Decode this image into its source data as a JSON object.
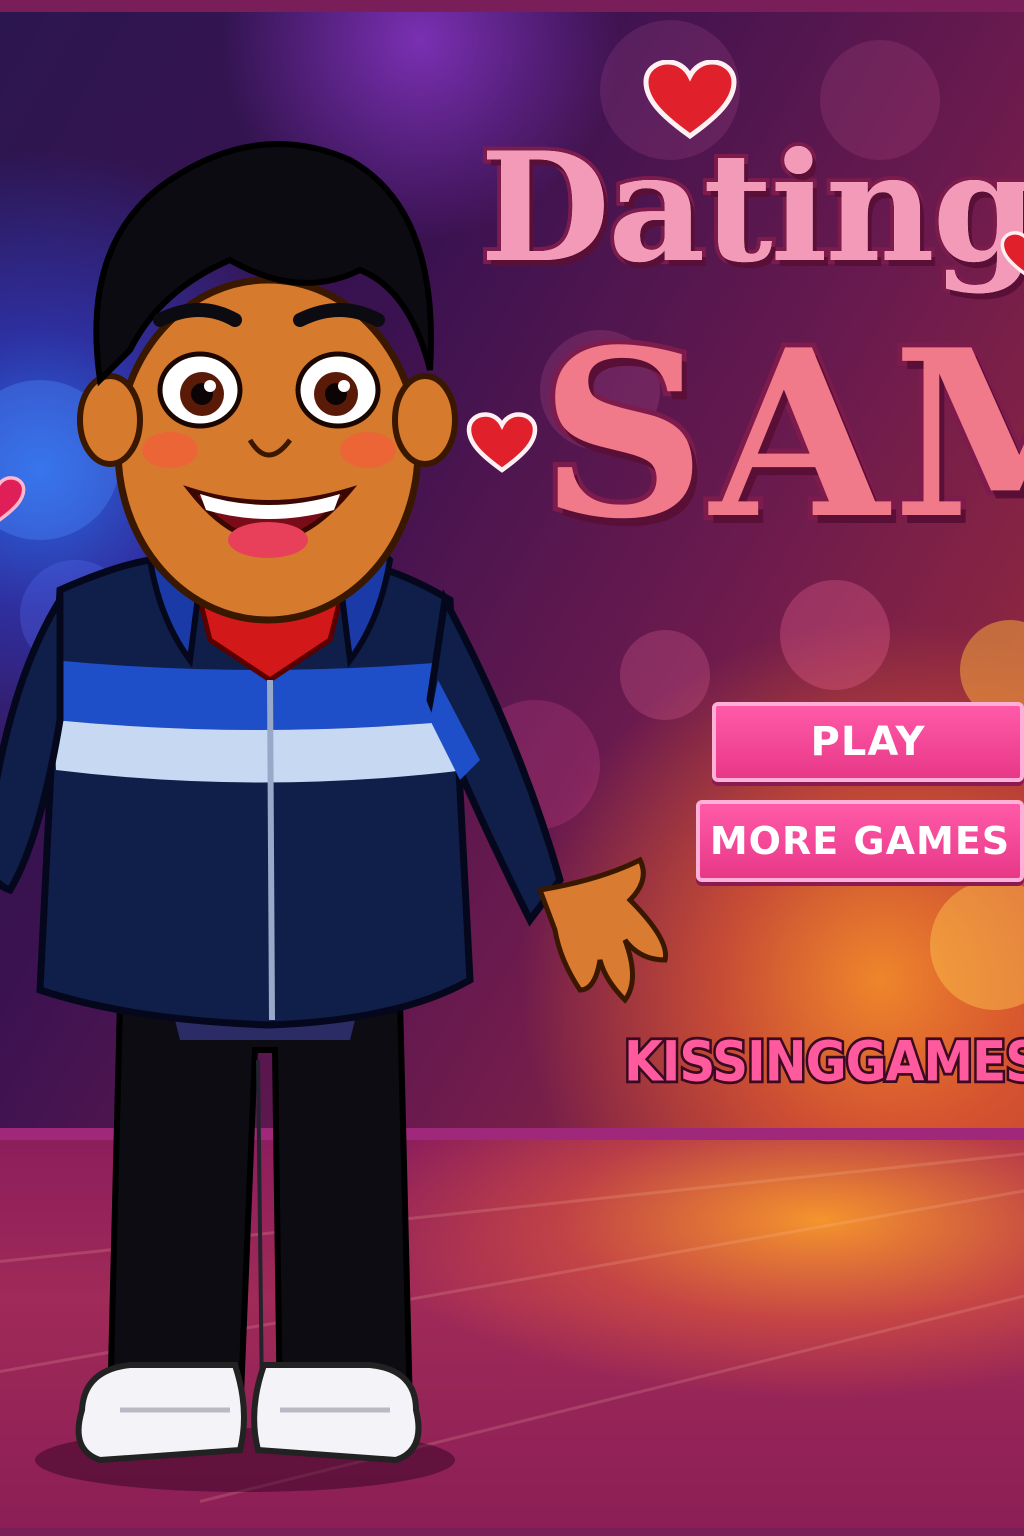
{
  "game": {
    "title_line1": "Dating",
    "title_line2": "SAM",
    "menu": {
      "play_label": "PLAY",
      "more_games_label": "MORE GAMES"
    },
    "site": "KISSINGGAMES.co"
  },
  "icons": [
    "heart-icon",
    "heart-icon",
    "heart-icon"
  ],
  "colors": {
    "button_pink": "#e83888",
    "title_pink": "#f29ab8",
    "title_outline": "#7c1b4c",
    "heart_red": "#e0202a"
  }
}
